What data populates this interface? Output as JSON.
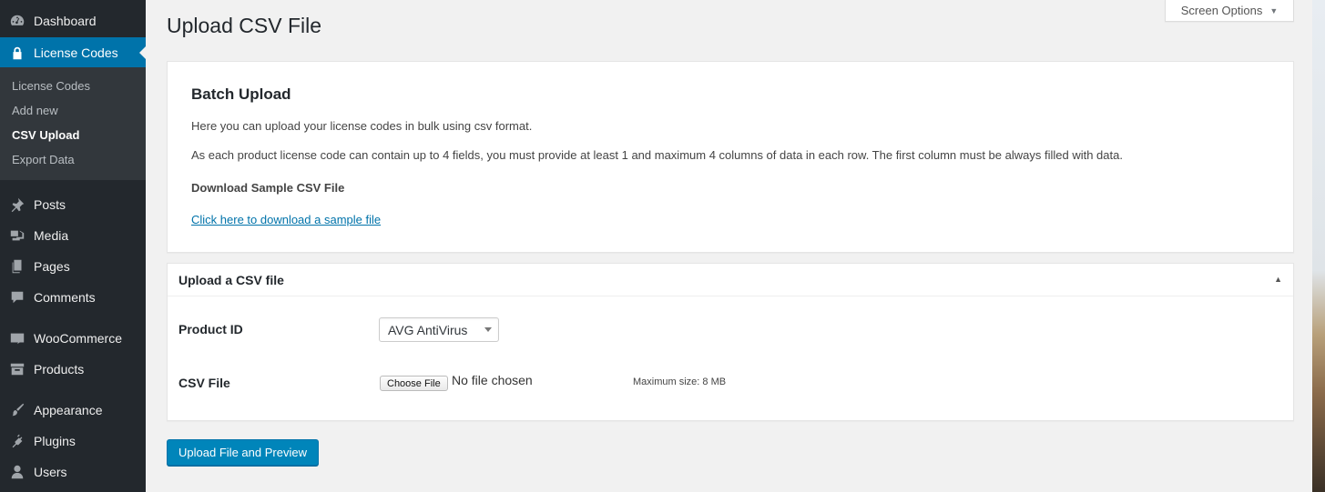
{
  "sidebar": {
    "dashboard": "Dashboard",
    "license_codes": "License Codes",
    "submenu": [
      "License Codes",
      "Add new",
      "CSV Upload",
      "Export Data"
    ],
    "posts": "Posts",
    "media": "Media",
    "pages": "Pages",
    "comments": "Comments",
    "woocommerce": "WooCommerce",
    "products": "Products",
    "appearance": "Appearance",
    "plugins": "Plugins",
    "users": "Users"
  },
  "header": {
    "title": "Upload CSV File",
    "screen_options": "Screen Options"
  },
  "batch": {
    "title": "Batch Upload",
    "p1": "Here you can upload your license codes in bulk using csv format.",
    "p2": "As each product license code can contain up to 4 fields, you must provide at least 1 and maximum 4 columns of data in each row. The first column must be always filled with data.",
    "download_heading": "Download Sample CSV File",
    "download_link": "Click here to download a sample file"
  },
  "upload": {
    "title": "Upload a CSV file",
    "product_id_label": "Product ID",
    "product_selected": "AVG AntiVirus",
    "csv_label": "CSV File",
    "choose_file": "Choose File",
    "no_file": "No file chosen",
    "max_size": "Maximum size: 8 MB",
    "submit": "Upload File and Preview"
  },
  "colors": {
    "sidebar_bg": "#23282d",
    "accent": "#0073aa",
    "button": "#0085ba"
  }
}
